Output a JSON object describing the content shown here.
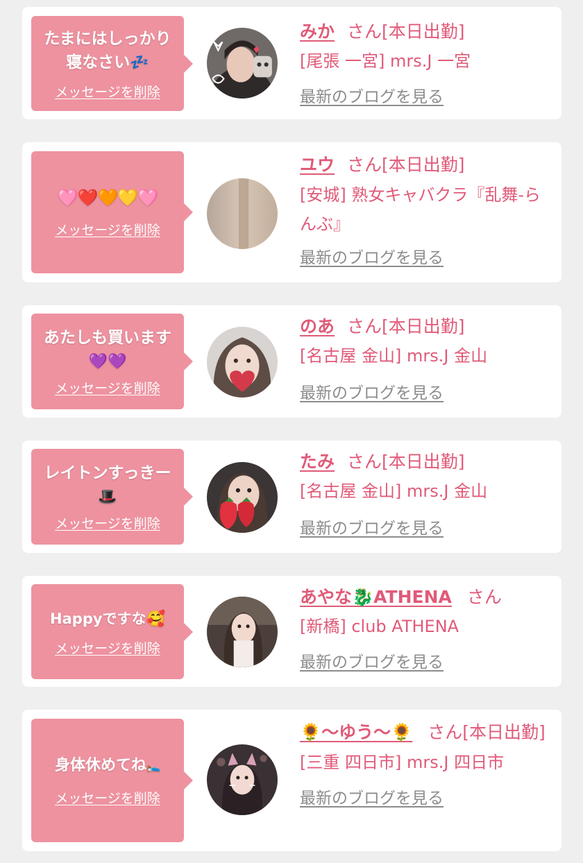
{
  "colors": {
    "accent": "#e05a78",
    "bubble": "#ee92a0",
    "link_gray": "#8c8c8c",
    "background": "#efefef"
  },
  "entries": [
    {
      "message": "たまにはしっかり寝なさい",
      "message_emoji": "💤",
      "delete_label": "メッセージを削除",
      "name": "みか",
      "suffix": "さん[本日出勤]",
      "shop": "[尾張 一宮] mrs.J 一宮",
      "blog_label": "最新のブログを見る",
      "avatar_icon": "profile-photo-woman-with-cat-stickers"
    },
    {
      "message": "",
      "message_emoji": "🩷❤️🧡💛🩷",
      "delete_label": "メッセージを削除",
      "name": "ユウ",
      "suffix": "さん[本日出勤]",
      "shop": "[安城] 熟女キャバクラ『乱舞-らんぶ』",
      "blog_label": "最新のブログを見る",
      "avatar_icon": "profile-photo-blurred-beige"
    },
    {
      "message": "あたしも買います",
      "message_emoji": "💜💜",
      "delete_label": "メッセージを削除",
      "name": "のあ",
      "suffix": "さん[本日出勤]",
      "shop": "[名古屋 金山] mrs.J 金山",
      "blog_label": "最新のブログを見る",
      "avatar_icon": "profile-photo-woman-heart-mask"
    },
    {
      "message": "レイトンすっきー",
      "message_emoji": "🎩",
      "delete_label": "メッセージを削除",
      "name": "たみ",
      "suffix": "さん[本日出勤]",
      "shop": "[名古屋 金山] mrs.J 金山",
      "blog_label": "最新のブログを見る",
      "avatar_icon": "profile-photo-woman-strawberry"
    },
    {
      "message": "Happyですな",
      "message_emoji": "🥰",
      "delete_label": "メッセージを削除",
      "name": "あやな🐉ATHENA",
      "suffix": "さん",
      "shop": "[新橋] club ATHENA",
      "blog_label": "最新のブログを見る",
      "avatar_icon": "profile-photo-woman-dark-room"
    },
    {
      "message": "身体休めてね",
      "message_emoji": "🛌",
      "delete_label": "メッセージを削除",
      "name": "🌻〜ゆう〜🌻",
      "suffix": "さん[本日出勤]",
      "shop": "[三重 四日市] mrs.J 四日市",
      "blog_label": "最新のブログを見る",
      "avatar_icon": "profile-photo-woman-cat-ears-filter"
    }
  ]
}
